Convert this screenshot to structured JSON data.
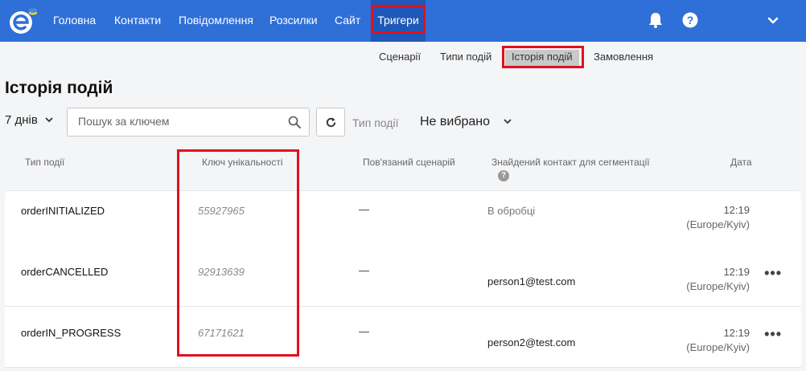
{
  "nav": {
    "items": [
      {
        "label": "Головна",
        "active": false
      },
      {
        "label": "Контакти",
        "active": false
      },
      {
        "label": "Повідомлення",
        "active": false
      },
      {
        "label": "Розсилки",
        "active": false
      },
      {
        "label": "Сайт",
        "active": false
      },
      {
        "label": "Тригери",
        "active": true
      }
    ],
    "icons": [
      "bell-icon",
      "help-icon",
      "chevron-down-icon"
    ]
  },
  "subtabs": [
    {
      "label": "Сценарії",
      "active": false
    },
    {
      "label": "Типи подій",
      "active": false
    },
    {
      "label": "Історія подій",
      "active": true
    },
    {
      "label": "Замовлення",
      "active": false
    }
  ],
  "page": {
    "title": "Історія подій"
  },
  "filters": {
    "period": "7 днів",
    "search_placeholder": "Пошук за ключем",
    "event_type_label": "Тип події",
    "event_type_value": "Не вибрано"
  },
  "table": {
    "headers": {
      "type": "Тип події",
      "key": "Ключ унікальності",
      "scenario": "Пов'язаний сценарій",
      "contact": "Знайдений контакт для сегментації",
      "date": "Дата"
    },
    "rows": [
      {
        "type": "orderINITIALIZED",
        "key": "55927965",
        "scenario": "—",
        "contact": "В обробці",
        "time": "12:19",
        "tz": "(Europe/Kyiv)",
        "menu": false
      },
      {
        "type": "orderCANCELLED",
        "key": "92913639",
        "scenario": "—",
        "contact": "person1@test.com",
        "time": "12:19",
        "tz": "(Europe/Kyiv)",
        "menu": true
      },
      {
        "type": "orderIN_PROGRESS",
        "key": "67171621",
        "scenario": "—",
        "contact": "person2@test.com",
        "time": "12:19",
        "tz": "(Europe/Kyiv)",
        "menu": true
      }
    ]
  },
  "colors": {
    "brand": "#2f6fd8",
    "highlight": "#e0101e"
  }
}
